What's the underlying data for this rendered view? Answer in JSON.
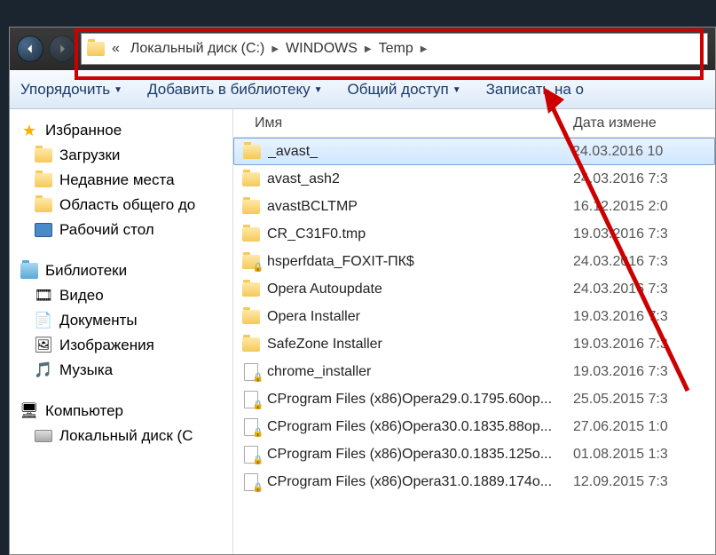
{
  "breadcrumb": {
    "overflow": "«",
    "parts": [
      "Локальный диск (C:)",
      "WINDOWS",
      "Temp"
    ]
  },
  "toolbar": {
    "organize": "Упорядочить",
    "library": "Добавить в библиотеку",
    "share": "Общий доступ",
    "burn": "Записать на о"
  },
  "sidebar": {
    "favorites": {
      "label": "Избранное",
      "items": [
        "Загрузки",
        "Недавние места",
        "Область общего до",
        "Рабочий стол"
      ]
    },
    "libraries": {
      "label": "Библиотеки",
      "items": [
        "Видео",
        "Документы",
        "Изображения",
        "Музыка"
      ]
    },
    "computer": {
      "label": "Компьютер",
      "items": [
        "Локальный диск (C"
      ]
    }
  },
  "columns": {
    "name": "Имя",
    "date": "Дата измене"
  },
  "files": [
    {
      "name": "_avast_",
      "date": "24.03.2016 10",
      "type": "folder",
      "selected": true
    },
    {
      "name": "avast_ash2",
      "date": "24.03.2016 7:3",
      "type": "folder"
    },
    {
      "name": "avastBCLTMP",
      "date": "16.12.2015 2:0",
      "type": "folder"
    },
    {
      "name": "CR_C31F0.tmp",
      "date": "19.03.2016 7:3",
      "type": "folder"
    },
    {
      "name": "hsperfdata_FOXIT-ПК$",
      "date": "24.03.2016 7:3",
      "type": "folder",
      "locked": true
    },
    {
      "name": "Opera Autoupdate",
      "date": "24.03.2016 7:3",
      "type": "folder"
    },
    {
      "name": "Opera Installer",
      "date": "19.03.2016 7:3",
      "type": "folder"
    },
    {
      "name": "SafeZone Installer",
      "date": "19.03.2016 7:3",
      "type": "folder"
    },
    {
      "name": "chrome_installer",
      "date": "19.03.2016 7:3",
      "type": "file",
      "locked": true
    },
    {
      "name": "CProgram Files (x86)Opera29.0.1795.60op...",
      "date": "25.05.2015 7:3",
      "type": "file",
      "locked": true
    },
    {
      "name": "CProgram Files (x86)Opera30.0.1835.88op...",
      "date": "27.06.2015 1:0",
      "type": "file",
      "locked": true
    },
    {
      "name": "CProgram Files (x86)Opera30.0.1835.125o...",
      "date": "01.08.2015 1:3",
      "type": "file",
      "locked": true
    },
    {
      "name": "CProgram Files (x86)Opera31.0.1889.174o...",
      "date": "12.09.2015 7:3",
      "type": "file",
      "locked": true
    }
  ]
}
